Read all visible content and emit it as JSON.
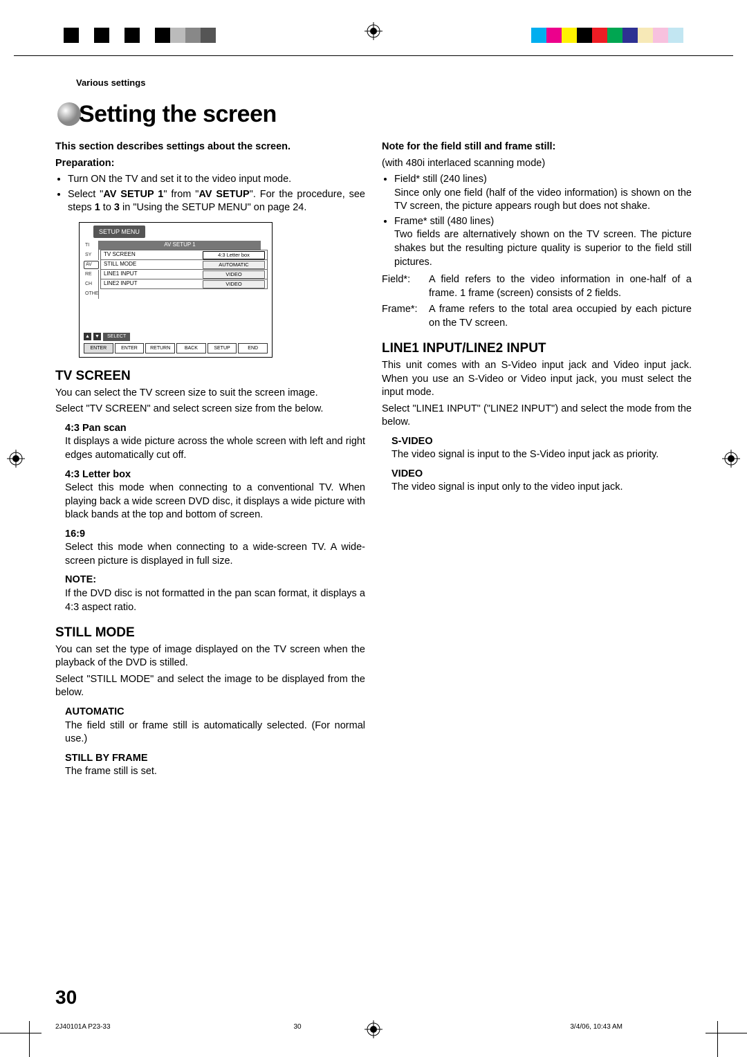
{
  "breadcrumb": "Various settings",
  "title": "Setting the screen",
  "left": {
    "intro": "This section describes settings about the screen.",
    "prep_h": "Preparation:",
    "prep1": "Turn ON the TV and set it to the video input mode.",
    "prep2a": "Select \"",
    "prep2b": "AV SETUP 1",
    "prep2c": "\" from \"",
    "prep2d": "AV SETUP",
    "prep2e": "\". For the procedure, see steps ",
    "prep2f": "1",
    "prep2g": " to ",
    "prep2h": "3",
    "prep2i": " in \"Using the SETUP MENU\" on page 24.",
    "menu": {
      "header": "SETUP MENU",
      "subtitle": "AV SETUP 1",
      "side": [
        "TI",
        "SY",
        "AV",
        "RE",
        "CH",
        "OTHER"
      ],
      "rows": [
        {
          "l": "TV SCREEN",
          "r": "4:3 Letter box",
          "sel": true
        },
        {
          "l": "STILL MODE",
          "r": "AUTOMATIC"
        },
        {
          "l": "LINE1 INPUT",
          "r": "VIDEO"
        },
        {
          "l": "LINE2 INPUT",
          "r": "VIDEO"
        }
      ],
      "select": "SELECT",
      "btns": [
        "ENTER",
        "ENTER",
        "RETURN",
        "BACK",
        "SETUP",
        "END"
      ]
    },
    "tvscreen_h": "TV SCREEN",
    "tvscreen_p1": "You can select the TV screen size to suit the screen image.",
    "tvscreen_p2": "Select \"TV SCREEN\" and select screen size from the below.",
    "ps_h": "4:3 Pan scan",
    "ps_p": "It displays a wide picture across the whole screen with left and right edges automatically cut off.",
    "lb_h": "4:3 Letter box",
    "lb_p": "Select this mode when connecting to a conventional TV. When playing back a wide screen DVD disc, it displays a wide picture with black bands at the top and bottom of screen.",
    "w_h": "16:9",
    "w_p": "Select this mode when connecting to a wide-screen TV. A wide-screen picture is displayed in full size.",
    "note_h": "NOTE:",
    "note_p": "If the DVD disc is not formatted in the pan scan format, it displays a 4:3 aspect ratio.",
    "still_h": "STILL MODE",
    "still_p1": "You can set the type of image displayed on the TV screen when the playback of the DVD is stilled.",
    "still_p2": "Select \"STILL MODE\" and select the image to be displayed from the below.",
    "auto_h": "AUTOMATIC",
    "auto_p": "The field still or frame still is automatically selected. (For normal use.)",
    "sbf_h": "STILL BY FRAME",
    "sbf_p": "The frame still is set."
  },
  "right": {
    "nff_h": "Note for the field still and frame still:",
    "nff_sub": "(with 480i interlaced scanning mode)",
    "b1_h": "Field* still (240 lines)",
    "b1_p": "Since only one field (half of the video information) is shown on the TV screen, the picture appears rough but does not shake.",
    "b2_h": "Frame* still (480 lines)",
    "b2_p": "Two fields are alternatively shown on the TV screen. The picture shakes but the resulting picture quality is superior to the field still pictures.",
    "def1_k": "Field*:",
    "def1_v": "A field refers to the video information in one-half of a frame. 1 frame (screen) consists of 2 fields.",
    "def2_k": "Frame*:",
    "def2_v": "A frame refers to the total area occupied by each picture on the TV screen.",
    "line_h": "LINE1 INPUT/LINE2 INPUT",
    "line_p1": "This unit comes with an S-Video input jack and Video input jack. When you use an S-Video or Video input jack, you must select the input mode.",
    "line_p2": "Select \"LINE1 INPUT\" (\"LINE2 INPUT\") and select the mode from the below.",
    "sv_h": "S-VIDEO",
    "sv_p": "The video signal is input to the S-Video input jack as priority.",
    "v_h": "VIDEO",
    "v_p": "The video signal is input only to the video input jack."
  },
  "page_number": "30",
  "footer_left": "2J40101A P23-33",
  "footer_center": "30",
  "footer_right": "3/4/06, 10:43 AM"
}
